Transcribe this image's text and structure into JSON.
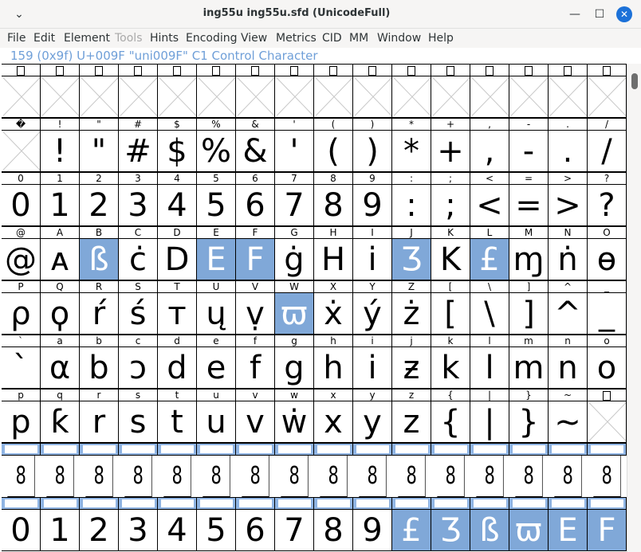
{
  "window": {
    "title": "ing55u  ing55u.sfd (UnicodeFull)",
    "menu_icon": "chevron-down-icon",
    "minimize_icon": "minimize-icon",
    "maximize_icon": "maximize-icon",
    "close_icon": "close-icon"
  },
  "menubar": [
    {
      "label": "File",
      "enabled": true
    },
    {
      "label": "Edit",
      "enabled": true
    },
    {
      "label": "Element",
      "enabled": true
    },
    {
      "label": "Tools",
      "enabled": false
    },
    {
      "label": "Hints",
      "enabled": true
    },
    {
      "label": "Encoding",
      "enabled": true
    },
    {
      "label": "View",
      "enabled": true
    },
    {
      "label": "Metrics",
      "enabled": true
    },
    {
      "label": "CID",
      "enabled": true
    },
    {
      "label": "MM",
      "enabled": true
    },
    {
      "label": "Window",
      "enabled": true
    },
    {
      "label": "Help",
      "enabled": true
    }
  ],
  "info_line": "159 (0x9f) U+009F \"uni009F\" C1 Control Character",
  "colors": {
    "selected": "#80a8d8",
    "info_text": "#6f9fd8",
    "close_button": "#1c71d8"
  },
  "grid_rows": [
    {
      "labels": [
        "10",
        "11",
        "12",
        "13",
        "14",
        "15",
        "16",
        "17",
        "18",
        "19",
        "1A",
        "1B",
        "1C",
        "1D",
        "1E",
        "1F"
      ],
      "label_kind": "hexbox",
      "glyphs": [
        "",
        "",
        "",
        "",
        "",
        "",
        "",
        "",
        "",
        "",
        "",
        "",
        "",
        "",
        "",
        ""
      ],
      "empty": [
        true,
        true,
        true,
        true,
        true,
        true,
        true,
        true,
        true,
        true,
        true,
        true,
        true,
        true,
        true,
        true
      ],
      "selected": []
    },
    {
      "labels": [
        "�",
        "!",
        "\"",
        "#",
        "$",
        "%",
        "&",
        "'",
        "(",
        ")",
        "*",
        "+",
        ",",
        "-",
        ".",
        "/"
      ],
      "label_kind": "text",
      "glyphs": [
        "",
        "!",
        "\"",
        "#",
        "$",
        "%",
        "&",
        "'",
        "(",
        ")",
        "*",
        "+",
        ",",
        "-",
        ".",
        "/"
      ],
      "empty": [
        false
      ],
      "selected": []
    },
    {
      "labels": [
        "0",
        "1",
        "2",
        "3",
        "4",
        "5",
        "6",
        "7",
        "8",
        "9",
        ":",
        ";",
        "<",
        "=",
        ">",
        "?"
      ],
      "label_kind": "text",
      "glyphs": [
        "0",
        "1",
        "2",
        "3",
        "4",
        "5",
        "6",
        "7",
        "8",
        "9",
        ":",
        ";",
        "<",
        "=",
        ">",
        "?"
      ],
      "selected": []
    },
    {
      "labels": [
        "@",
        "A",
        "B",
        "C",
        "D",
        "E",
        "F",
        "G",
        "H",
        "I",
        "J",
        "K",
        "L",
        "M",
        "N",
        "O"
      ],
      "label_kind": "text",
      "glyphs": [
        "@",
        "ᴀ",
        "ß",
        "ċ",
        "D",
        "E",
        "F",
        "ġ",
        "H",
        "i",
        "Ʒ",
        "K",
        "£",
        "ɱ",
        "ṅ",
        "ɵ"
      ],
      "selected": [
        2,
        5,
        6,
        10,
        12
      ]
    },
    {
      "labels": [
        "P",
        "Q",
        "R",
        "S",
        "T",
        "U",
        "V",
        "W",
        "X",
        "Y",
        "Z",
        "[",
        "\\",
        "]",
        "^",
        "_"
      ],
      "label_kind": "text",
      "glyphs": [
        "ρ",
        "ϙ",
        "ŕ",
        "ś",
        "т",
        "ų",
        "ṿ",
        "ϖ",
        "ẋ",
        "ý",
        "ż",
        "[",
        "\\",
        "]",
        "^",
        "_"
      ],
      "selected": [
        7
      ]
    },
    {
      "labels": [
        "`",
        "a",
        "b",
        "c",
        "d",
        "e",
        "f",
        "g",
        "h",
        "i",
        "j",
        "k",
        "l",
        "m",
        "n",
        "o"
      ],
      "label_kind": "text",
      "glyphs": [
        "`",
        "α",
        "b",
        "ɔ",
        "d",
        "e",
        "f",
        "g",
        "h",
        "i",
        "ƶ",
        "k",
        "l",
        "m",
        "n",
        "o"
      ],
      "selected": []
    },
    {
      "labels": [
        "p",
        "q",
        "r",
        "s",
        "t",
        "u",
        "v",
        "w",
        "x",
        "y",
        "z",
        "{",
        "|",
        "}",
        "~",
        "7F"
      ],
      "label_kind": "text",
      "glyphs": [
        "p",
        "ƙ",
        "r",
        "s",
        "t",
        "u",
        "v",
        "ẇ",
        "x",
        "y",
        "z",
        "{",
        "|",
        "}",
        "~",
        ""
      ],
      "selected": []
    },
    {
      "labels": [
        "",
        "",
        "",
        "",
        "",
        "",
        "",
        "",
        "",
        "",
        "",
        "",
        "",
        "",
        "",
        ""
      ],
      "label_kind": "strip",
      "glyphs": [
        "8",
        "8",
        "8",
        "8",
        "8",
        "8",
        "8",
        "8",
        "8",
        "8",
        "8",
        "8",
        "8",
        "8",
        "8",
        "8"
      ],
      "selected": []
    },
    {
      "labels": [
        "",
        "",
        "",
        "",
        "",
        "",
        "",
        "",
        "",
        "",
        "",
        "",
        "",
        "",
        "",
        ""
      ],
      "label_kind": "strip",
      "glyphs": [
        "0",
        "1",
        "2",
        "3",
        "4",
        "5",
        "6",
        "7",
        "8",
        "9",
        "£",
        "Ʒ",
        "ß",
        "ϖ",
        "E",
        "F"
      ],
      "selected": [
        10,
        11,
        12,
        13,
        14,
        15
      ]
    }
  ]
}
